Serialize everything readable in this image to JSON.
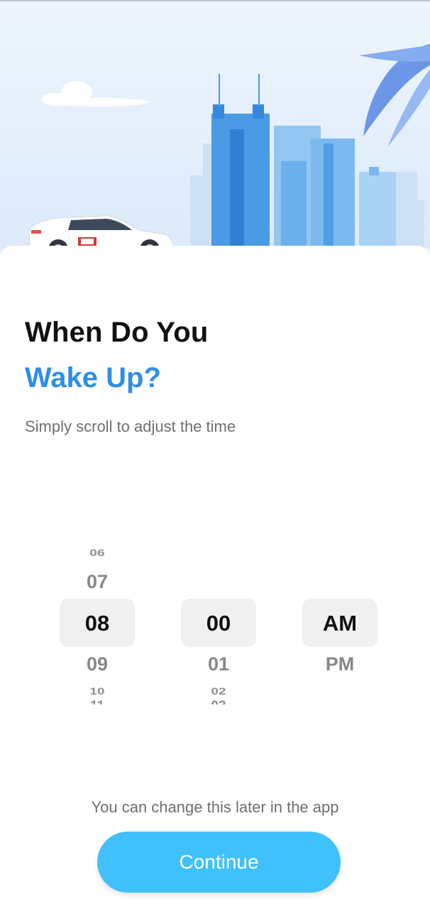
{
  "header": {
    "title_line1": "When Do You",
    "title_line2": "Wake Up?",
    "subtitle": "Simply scroll to adjust the time"
  },
  "time_picker": {
    "hour": {
      "above2": "06",
      "above1": "07",
      "selected": "08",
      "below1": "09",
      "below2": "10"
    },
    "minute": {
      "above2": "",
      "above1": "",
      "selected": "00",
      "below1": "01",
      "below2": "02"
    },
    "period": {
      "selected": "AM",
      "below1": "PM"
    }
  },
  "footer": {
    "note": "You can change this later in the app",
    "continue_label": "Continue"
  },
  "colors": {
    "accent_text": "#2e8ee6",
    "button": "#41c1fb",
    "selection_bg": "#f0f0f0"
  },
  "icons": {
    "hero": "city-car-illustration"
  }
}
